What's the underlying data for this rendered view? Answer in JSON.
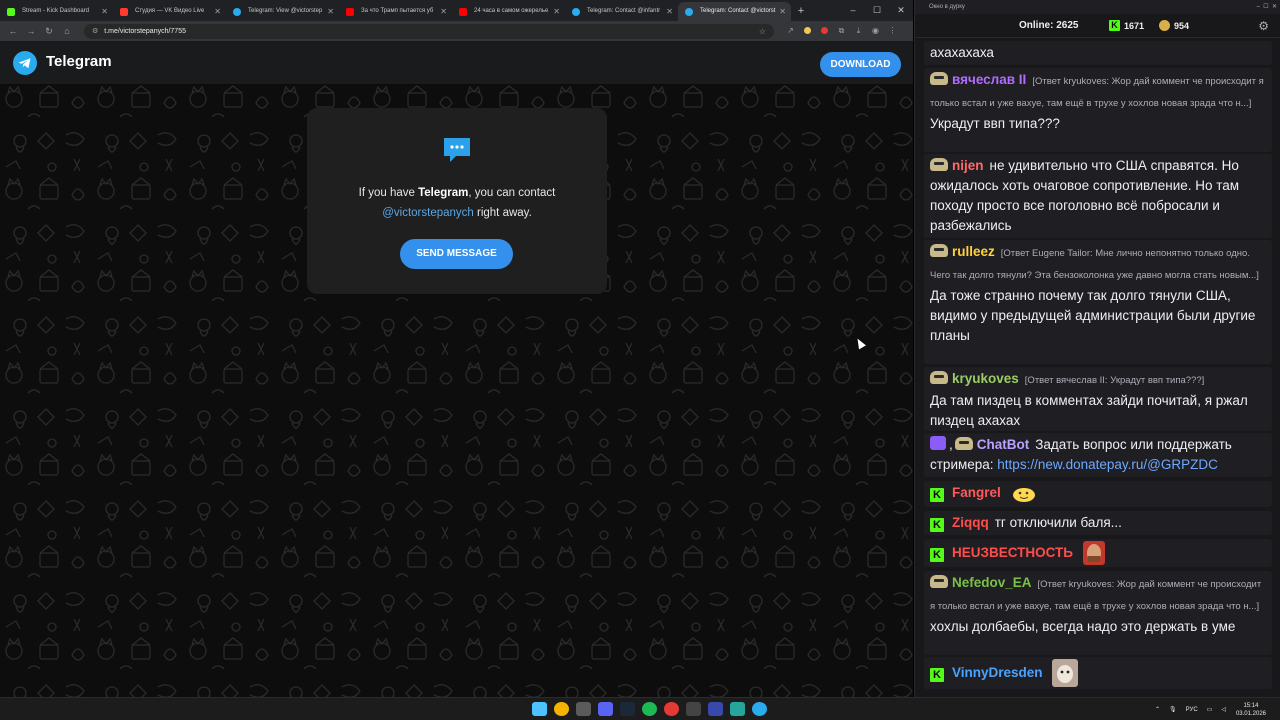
{
  "browser": {
    "tabs": [
      {
        "title": "Stream - Kick Dashboard",
        "color": "#53fc18"
      },
      {
        "title": "Студия — VK Видео Live",
        "color": "#ff3b30"
      },
      {
        "title": "Telegram: View @victorstep",
        "color": "#2aabee"
      },
      {
        "title": "За что Трамп пытается уб",
        "color": "#ff0000"
      },
      {
        "title": "24 часа в самом ожерелье",
        "color": "#ff0000"
      },
      {
        "title": "Telegram: Contact @infantr",
        "color": "#2aabee"
      },
      {
        "title": "Telegram: Contact @victorst",
        "color": "#2aabee"
      }
    ],
    "active_tab_index": 6,
    "url": "t.me/victorstepanych/7755",
    "new_tab_symbol": "+",
    "window_controls": [
      "–",
      "☐",
      "✕"
    ]
  },
  "telegram": {
    "brand": "Telegram",
    "download_label": "DOWNLOAD",
    "card_line1_prefix": "If you have ",
    "card_line1_bold": "Telegram",
    "card_line1_suffix": ", you can contact",
    "card_handle": "@victorstepanych",
    "card_line2_suffix": " right away.",
    "send_label": "SEND MESSAGE",
    "accent_color": "#3390ec"
  },
  "chat": {
    "window_title": "Окно в дурку",
    "online_label": "Online:",
    "online_count": "2625",
    "kick_count": "1671",
    "coin_count": "954",
    "messages": [
      {
        "user": "",
        "reply": "",
        "text": "ахахахаха",
        "color": "#efeff1",
        "badge": "none"
      },
      {
        "user": "вячеслав II",
        "reply": "[Ответ kryukoves: Жор дай коммент че происходит я только встал и уже вахуе, там ещё в трухе у хохлов новая зрада что н...]",
        "text": "Украдут ввп типа???",
        "color": "#b16cff",
        "badge": "sub"
      },
      {
        "user": "nijen",
        "reply": "",
        "text": "не удивительно что США справятся. Но ожидалось хоть очаговое сопротивление. Но там походу просто все поголовно всё побросали и разбежались",
        "color": "#ff6b6b",
        "badge": "sub"
      },
      {
        "user": "rulleez",
        "reply": "[Ответ Eugene Tailor: Мне лично непонятно только одно. Чего так долго тянули? Эта бензоколонка уже давно могла стать новым...]",
        "text": "Да тоже странно почему так долго тянули США, видимо у предыдущей администрации были другие планы",
        "color": "#ffd23f",
        "badge": "sub"
      },
      {
        "user": "kryukoves",
        "reply": "[Ответ вячеслав II: Украдут ввп типа???]",
        "text": "Да там пиздец в комментах зайди почитай, я ржал пиздец ахахах",
        "color": "#9ccc65",
        "badge": "sub"
      },
      {
        "user": "ChatBot",
        "reply": "",
        "text": "Задать вопрос или поддержать стримера: ",
        "link": "https://new.donatepay.ru/@GRPZDC",
        "color": "#b9a3ff",
        "badge": "bot"
      },
      {
        "user": "Fangrel",
        "reply": "",
        "text": "",
        "color": "#ff5a5a",
        "badge": "kick"
      },
      {
        "user": "Ziqqq",
        "reply": "",
        "text": "тг отключили баля...",
        "color": "#ff4d4d",
        "badge": "kick"
      },
      {
        "user": "НЕUЗВЕСТНОСТЬ",
        "reply": "",
        "text": "",
        "color": "#ff4d4d",
        "badge": "kick"
      },
      {
        "user": "Nefedov_EA",
        "reply": "[Ответ kryukoves: Жор дай коммент че происходит я только встал и уже вахуе, там ещё в трухе у хохлов новая зрада что н...]",
        "text": "хохлы долбаебы, всегда надо это держать в уме",
        "color": "#7bc043",
        "badge": "sub"
      },
      {
        "user": "VinnyDresden",
        "reply": "",
        "text": "",
        "color": "#4aa3ff",
        "badge": "kick"
      }
    ]
  },
  "taskbar": {
    "language": "РУС",
    "time": "15:14",
    "date": "03.01.2026"
  }
}
